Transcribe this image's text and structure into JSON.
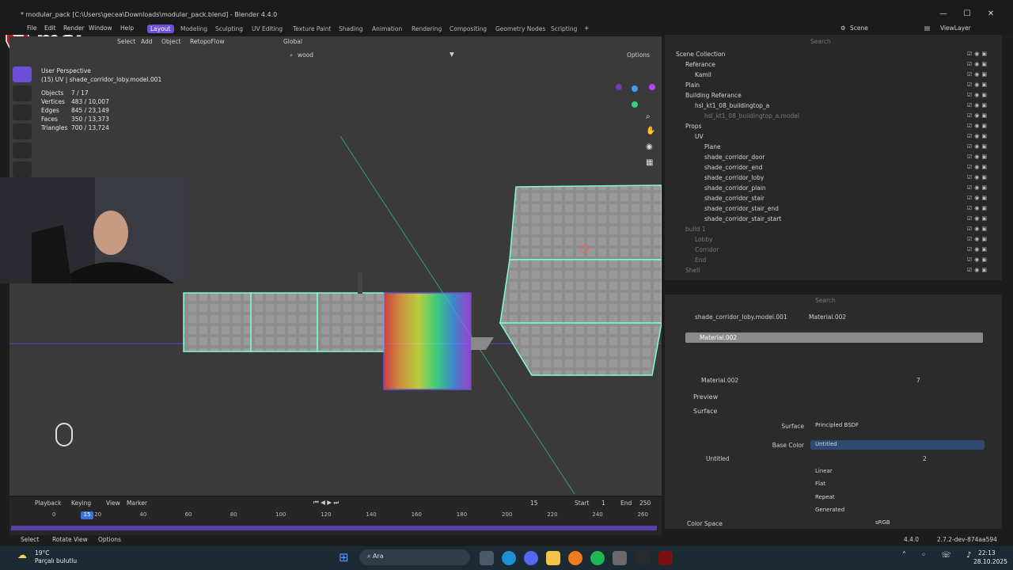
{
  "window": {
    "title": "* modular_pack [C:\\Users\\gecea\\Downloads\\modular_pack.blend] - Blender 4.4.0",
    "brand_logo_text": "msi"
  },
  "menu": [
    "File",
    "Edit",
    "Render",
    "Window",
    "Help"
  ],
  "workspaces": [
    "Layout",
    "Modeling",
    "Sculpting",
    "UV Editing",
    "Texture Paint",
    "Shading",
    "Animation",
    "Rendering",
    "Compositing",
    "Geometry Nodes",
    "Scripting"
  ],
  "scene": {
    "label": "Scene",
    "viewlayer": "ViewLayer"
  },
  "viewport_header": {
    "select": "Select",
    "add": "Add",
    "object": "Object",
    "retopoflow": "RetopoFlow",
    "orientation": "Global",
    "search_value": "wood",
    "options": "Options"
  },
  "viewport": {
    "perspective": "User Perspective",
    "active_object": "(15) UV | shade_corridor_loby.model.001",
    "stats": [
      {
        "k": "Objects",
        "v": "7 / 17"
      },
      {
        "k": "Vertices",
        "v": "483 / 10,007"
      },
      {
        "k": "Edges",
        "v": "845 / 23,149"
      },
      {
        "k": "Faces",
        "v": "350 / 13,373"
      },
      {
        "k": "Triangles",
        "v": "700 / 13,724"
      }
    ]
  },
  "outliner": {
    "search_placeholder": "Search",
    "rows": [
      {
        "label": "Scene Collection",
        "indent": 0,
        "dim": false
      },
      {
        "label": "Referance",
        "indent": 1,
        "dim": false
      },
      {
        "label": "Kamil",
        "indent": 2,
        "dim": false
      },
      {
        "label": "Plain",
        "indent": 1,
        "dim": false
      },
      {
        "label": "Building Referance",
        "indent": 1,
        "dim": false
      },
      {
        "label": "hsl_kt1_08_buildingtop_a",
        "indent": 2,
        "dim": false
      },
      {
        "label": "hsl_kt1_08_buildingtop_a.model",
        "indent": 3,
        "dim": true
      },
      {
        "label": "Props",
        "indent": 1,
        "dim": false
      },
      {
        "label": "UV",
        "indent": 2,
        "dim": false
      },
      {
        "label": "Plane",
        "indent": 3,
        "dim": false
      },
      {
        "label": "shade_corridor_door",
        "indent": 3,
        "dim": false
      },
      {
        "label": "shade_corridor_end",
        "indent": 3,
        "dim": false
      },
      {
        "label": "shade_corridor_loby",
        "indent": 3,
        "dim": false
      },
      {
        "label": "shade_corridor_plain",
        "indent": 3,
        "dim": false
      },
      {
        "label": "shade_corridor_stair",
        "indent": 3,
        "dim": false
      },
      {
        "label": "shade_corridor_stair_end",
        "indent": 3,
        "dim": false
      },
      {
        "label": "shade_corridor_stair_start",
        "indent": 3,
        "dim": false
      },
      {
        "label": "build 1",
        "indent": 1,
        "dim": true
      },
      {
        "label": "Lobby",
        "indent": 2,
        "dim": true
      },
      {
        "label": "Corridor",
        "indent": 2,
        "dim": true
      },
      {
        "label": "End",
        "indent": 2,
        "dim": true
      },
      {
        "label": "Shell",
        "indent": 1,
        "dim": true
      }
    ]
  },
  "properties": {
    "search_placeholder": "Search",
    "breadcrumb_object": "shade_corridor_loby.model.001",
    "breadcrumb_material": "Material.002",
    "slot": "Material.002",
    "material_name": "Material.002",
    "users": "7",
    "preview": "Preview",
    "surface": "Surface",
    "surface_label": "Surface",
    "surface_value": "Principled BSDF",
    "base_color_label": "Base Color",
    "base_color_value": "Untitled",
    "image_name": "Untitled",
    "image_users": "2",
    "interpolation": "Linear",
    "projection": "Flat",
    "extension": "Repeat",
    "source": "Generated",
    "color_space_label": "Color Space",
    "color_space": "sRGB"
  },
  "timeline": {
    "playback": "Playback",
    "keying": "Keying",
    "view": "View",
    "marker": "Marker",
    "current_frame": "15",
    "start_label": "Start",
    "start": "1",
    "end_label": "End",
    "end": "250",
    "ticks": [
      "0",
      "20",
      "40",
      "60",
      "80",
      "100",
      "120",
      "140",
      "160",
      "180",
      "200",
      "220",
      "240",
      "260"
    ],
    "frame_badge": "15"
  },
  "statusbar": {
    "select": "Select",
    "rotate": "Rotate View",
    "options": "Options",
    "version": "4.4.0",
    "build": "2.7.2-dev-874aa594"
  },
  "taskbar": {
    "weather_temp": "19°C",
    "weather_desc": "Parçalı bulutlu",
    "search": "Ara",
    "time": "22:13",
    "date": "28.10.2025"
  },
  "colors": {
    "accent": "#6d4fd8",
    "selection": "#7dffc6",
    "viewport_bg": "#3a3a3a"
  }
}
